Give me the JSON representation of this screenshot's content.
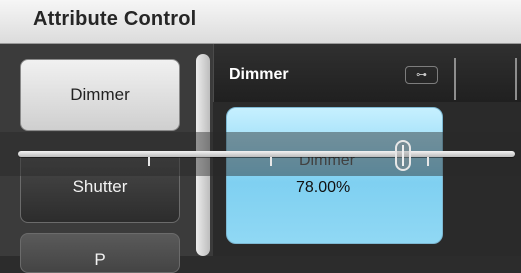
{
  "window": {
    "title": "Attribute Control"
  },
  "left_panel": {
    "items": [
      {
        "label": "Dimmer",
        "selected": true
      },
      {
        "label": "Shutter",
        "selected": false
      },
      {
        "label": "P",
        "selected": false
      }
    ]
  },
  "main": {
    "section_title": "Dimmer",
    "key_icon": "key-icon",
    "tile": {
      "name": "Dimmer",
      "value": "78.00%"
    }
  },
  "slider": {
    "value_percent": 78,
    "color": "#d9d9d9"
  },
  "colors": {
    "header_bg": "#e7e7e7",
    "panel_bg": "#2c2c2c",
    "accent_blue": "#8fd8f4"
  }
}
